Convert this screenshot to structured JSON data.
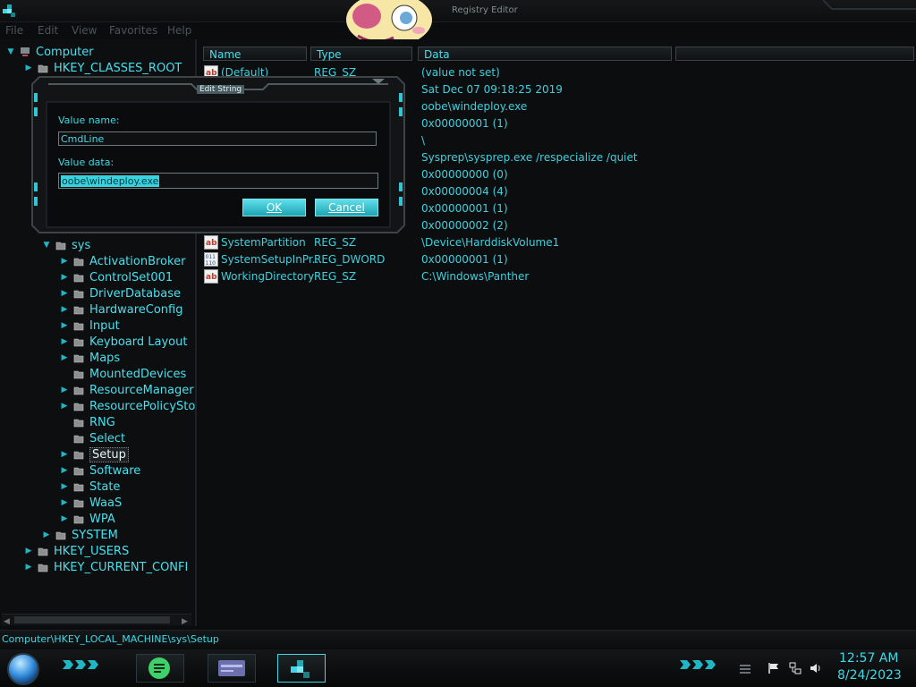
{
  "window": {
    "title": "Registry Editor"
  },
  "menu": [
    "File",
    "Edit",
    "View",
    "Favorites",
    "Help"
  ],
  "tree": {
    "root": "Computer",
    "items": [
      {
        "label": "HKEY_CLASSES_ROOT",
        "level": 1,
        "expander": true
      },
      {
        "label": "sys",
        "level": 2,
        "expander": true,
        "expanded": true
      },
      {
        "label": "ActivationBroker",
        "level": 3,
        "expander": true
      },
      {
        "label": "ControlSet001",
        "level": 3,
        "expander": true
      },
      {
        "label": "DriverDatabase",
        "level": 3,
        "expander": true
      },
      {
        "label": "HardwareConfig",
        "level": 3,
        "expander": true
      },
      {
        "label": "Input",
        "level": 3,
        "expander": true
      },
      {
        "label": "Keyboard Layout",
        "level": 3,
        "expander": true
      },
      {
        "label": "Maps",
        "level": 3,
        "expander": true
      },
      {
        "label": "MountedDevices",
        "level": 3,
        "expander": false
      },
      {
        "label": "ResourceManager",
        "level": 3,
        "expander": true
      },
      {
        "label": "ResourcePolicySto",
        "level": 3,
        "expander": true
      },
      {
        "label": "RNG",
        "level": 3,
        "expander": false
      },
      {
        "label": "Select",
        "level": 3,
        "expander": false
      },
      {
        "label": "Setup",
        "level": 3,
        "expander": true,
        "selected": true
      },
      {
        "label": "Software",
        "level": 3,
        "expander": true
      },
      {
        "label": "State",
        "level": 3,
        "expander": true
      },
      {
        "label": "WaaS",
        "level": 3,
        "expander": true
      },
      {
        "label": "WPA",
        "level": 3,
        "expander": true
      },
      {
        "label": "SYSTEM",
        "level": 2,
        "expander": true
      },
      {
        "label": "HKEY_USERS",
        "level": 1,
        "expander": true
      },
      {
        "label": "HKEY_CURRENT_CONFI",
        "level": 1,
        "expander": true
      }
    ]
  },
  "columns": [
    "Name",
    "Type",
    "Data"
  ],
  "values": [
    {
      "name": "(Default)",
      "type": "REG_SZ",
      "data": "(value not set)",
      "icon": "string-value-icon"
    },
    {
      "name": "",
      "type": "",
      "data": "Sat Dec 07 09:18:25 2019",
      "icon": ""
    },
    {
      "name": "",
      "type": "",
      "data": "oobe\\windeploy.exe",
      "icon": ""
    },
    {
      "name": "",
      "type": "",
      "data": "0x00000001 (1)",
      "icon": ""
    },
    {
      "name": "",
      "type": "",
      "data": "\\",
      "icon": ""
    },
    {
      "name": "",
      "type": "",
      "data": "Sysprep\\sysprep.exe /respecialize /quiet",
      "icon": ""
    },
    {
      "name": "",
      "type": "",
      "data": "0x00000000 (0)",
      "icon": ""
    },
    {
      "name": "",
      "type": "",
      "data": "0x00000004 (4)",
      "icon": ""
    },
    {
      "name": "",
      "type": "",
      "data": "0x00000001 (1)",
      "icon": ""
    },
    {
      "name": "",
      "type": "",
      "data": "0x00000002 (2)",
      "icon": ""
    },
    {
      "name": "SystemPartition",
      "type": "REG_SZ",
      "data": "\\Device\\HarddiskVolume1",
      "icon": "string-value-icon"
    },
    {
      "name": "SystemSetupInPr...",
      "type": "REG_DWORD",
      "data": "0x00000001 (1)",
      "icon": "dword-value-icon"
    },
    {
      "name": "WorkingDirectory",
      "type": "REG_SZ",
      "data": "C:\\Windows\\Panther",
      "icon": "string-value-icon"
    }
  ],
  "dialog": {
    "title": "Edit String",
    "value_name_label": "Value name:",
    "value_name": "CmdLine",
    "value_data_label": "Value data:",
    "value_data": "oobe\\windeploy.exe",
    "ok": "OK",
    "cancel": "Cancel"
  },
  "status": "Computer\\HKEY_LOCAL_MACHINE\\sys\\Setup",
  "taskbar": {
    "time": "12:57 AM",
    "date": "8/24/2023"
  },
  "colors": {
    "accent": "#3fd8e6",
    "background": "#0b0c0d",
    "button": "#2fbfcc"
  }
}
